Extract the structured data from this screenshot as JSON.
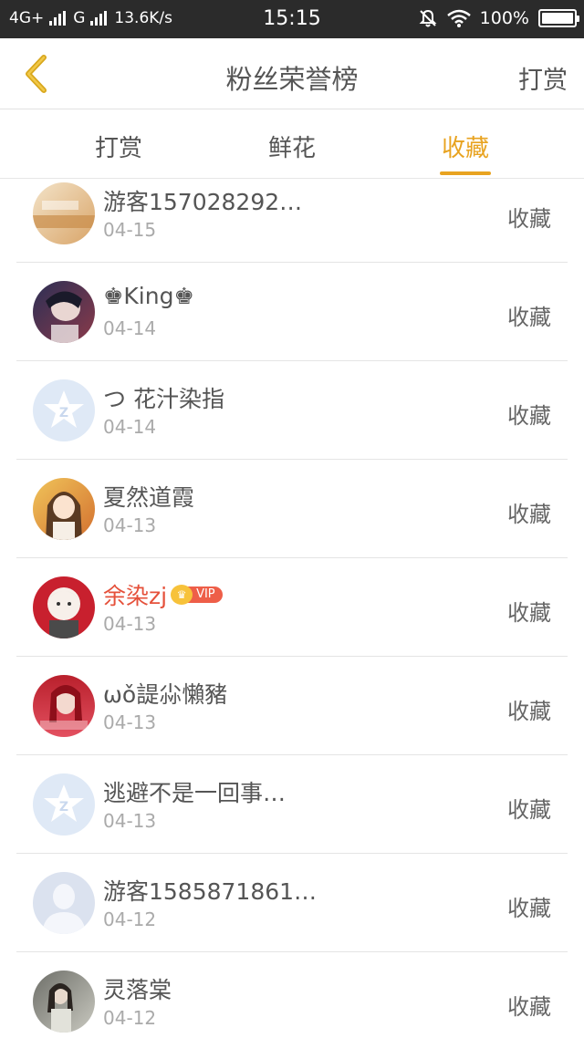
{
  "status_bar": {
    "network1": "4G+",
    "network2": "G",
    "speed": "13.6K/s",
    "time": "15:15",
    "battery": "100%"
  },
  "header": {
    "title": "粉丝荣誉榜",
    "right_action": "打赏"
  },
  "tabs": [
    {
      "label": "打赏",
      "active": false
    },
    {
      "label": "鲜花",
      "active": false
    },
    {
      "label": "收藏",
      "active": true
    }
  ],
  "accent_color": "#e8a320",
  "vip_name_color": "#e5513b",
  "vip_label": "VIP",
  "fans": [
    {
      "name": "游客157028292…",
      "date": "04-15",
      "action": "收藏",
      "avatar": "photo-warm",
      "vip": false
    },
    {
      "name": "♚King♚",
      "date": "04-14",
      "action": "收藏",
      "avatar": "photo-dark",
      "vip": false
    },
    {
      "name": "つ 花汁染指",
      "date": "04-14",
      "action": "收藏",
      "avatar": "default-qq-star",
      "vip": false
    },
    {
      "name": "夏然道霞",
      "date": "04-13",
      "action": "收藏",
      "avatar": "photo-anime-girl",
      "vip": false
    },
    {
      "name": "余染zj",
      "date": "04-13",
      "action": "收藏",
      "avatar": "photo-cartoon-red",
      "vip": true
    },
    {
      "name": "ωǒ諟尛懶豬",
      "date": "04-13",
      "action": "收藏",
      "avatar": "photo-red-hair",
      "vip": false
    },
    {
      "name": "逃避不是一回事…",
      "date": "04-13",
      "action": "收藏",
      "avatar": "default-qq-star",
      "vip": false
    },
    {
      "name": "游客1585871861…",
      "date": "04-12",
      "action": "收藏",
      "avatar": "default-person",
      "vip": false
    },
    {
      "name": "灵落棠",
      "date": "04-12",
      "action": "收藏",
      "avatar": "photo-girl",
      "vip": false
    }
  ]
}
